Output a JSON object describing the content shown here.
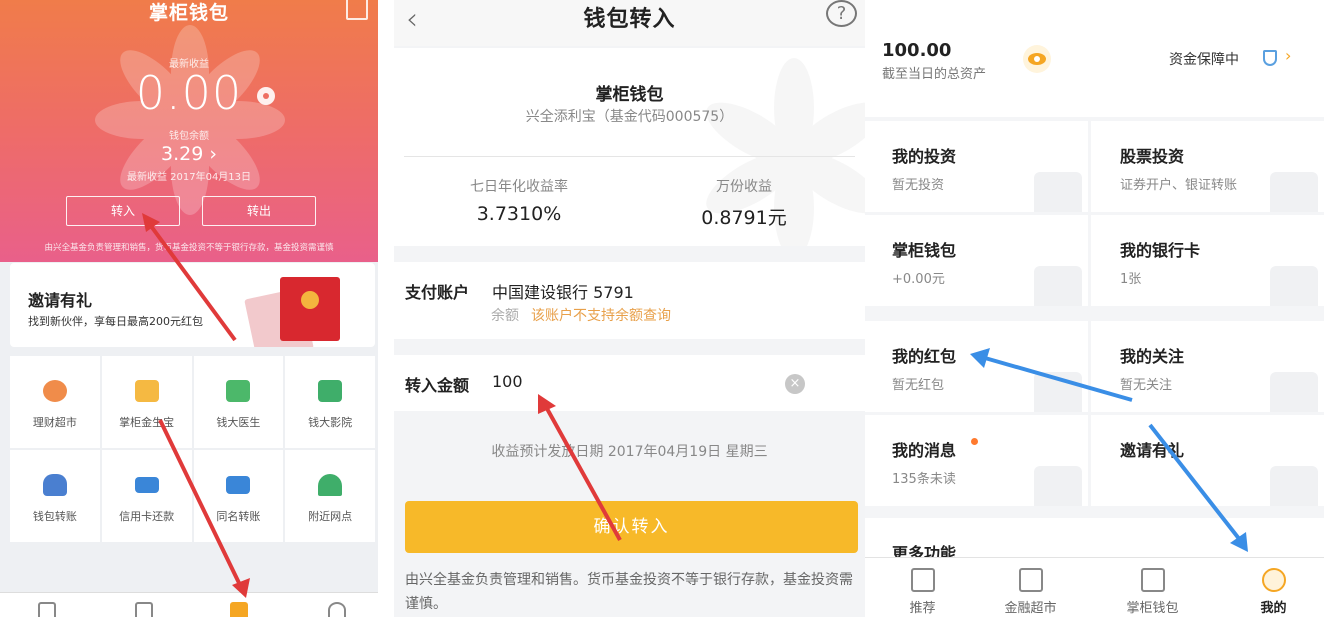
{
  "panel1": {
    "title": "掌柜钱包",
    "yesterday_label": "最新收益",
    "yesterday_value": "0.00",
    "balance_label": "钱包余额",
    "balance_value": "3.29 ›",
    "latest_date": "最新收益 2017年04月13日",
    "btn_in": "转入",
    "btn_out": "转出",
    "disclaimer": "由兴全基金负责管理和销售，货币基金投资不等于银行存款，基金投资需谨慎",
    "invite_title": "邀请有礼",
    "invite_sub": "找到新伙伴，享每日最高200元红包",
    "grid": [
      {
        "label": "理财超市",
        "icon": "pie-chart-icon",
        "color": "#f08c4a"
      },
      {
        "label": "掌柜金生宝",
        "icon": "gold-ingot-icon",
        "color": "#f5b942"
      },
      {
        "label": "钱大医生",
        "icon": "medical-kit-icon",
        "color": "#4cb86a"
      },
      {
        "label": "钱大影院",
        "icon": "film-icon",
        "color": "#3fae6a"
      },
      {
        "label": "钱包转账",
        "icon": "money-bag-icon",
        "color": "#4a7fd0"
      },
      {
        "label": "信用卡还款",
        "icon": "credit-card-icon",
        "color": "#3a86d8"
      },
      {
        "label": "同名转账",
        "icon": "id-card-icon",
        "color": "#3a86d8"
      },
      {
        "label": "附近网点",
        "icon": "map-pin-icon",
        "color": "#3fae6a"
      }
    ]
  },
  "panel2": {
    "title": "钱包转入",
    "help": "?",
    "back": "‹",
    "product_name": "掌柜钱包",
    "product_code": "兴全添利宝（基金代码000575）",
    "rate_label": "七日年化收益率",
    "rate_value": "3.7310%",
    "wanfen_label": "万份收益",
    "wanfen_value": "0.8791元",
    "pay_label": "支付账户",
    "pay_value": "中国建设银行 5791",
    "balance_hint_label": "余额",
    "balance_hint_value": "该账户不支持余额查询",
    "amount_label": "转入金额",
    "amount_value": "100",
    "date_text": "收益预计发放日期 2017年04月19日 星期三",
    "confirm": "确认转入",
    "footer": "由兴全基金负责管理和销售。货币基金投资不等于银行存款，基金投资需谨慎。"
  },
  "panel3": {
    "total": "100.00",
    "total_label": "截至当日的总资产",
    "safe": "资金保障中",
    "tiles": [
      {
        "title": "我的投资",
        "sub": "暂无投资"
      },
      {
        "title": "股票投资",
        "sub": "证券开户、银证转账"
      },
      {
        "title": "掌柜钱包",
        "sub": "+0.00元"
      },
      {
        "title": "我的银行卡",
        "sub": "1张"
      },
      {
        "title": "我的红包",
        "sub": "暂无红包"
      },
      {
        "title": "我的关注",
        "sub": "暂无关注"
      },
      {
        "title": "我的消息",
        "sub": "135条未读"
      },
      {
        "title": "邀请有礼",
        "sub": ""
      },
      {
        "title": "更多功能",
        "sub": ""
      }
    ],
    "nav": [
      {
        "label": "推荐",
        "icon": "building-icon"
      },
      {
        "label": "金融超市",
        "icon": "basket-icon"
      },
      {
        "label": "掌柜钱包",
        "icon": "wallet-icon"
      },
      {
        "label": "我的",
        "icon": "profile-icon"
      }
    ]
  }
}
